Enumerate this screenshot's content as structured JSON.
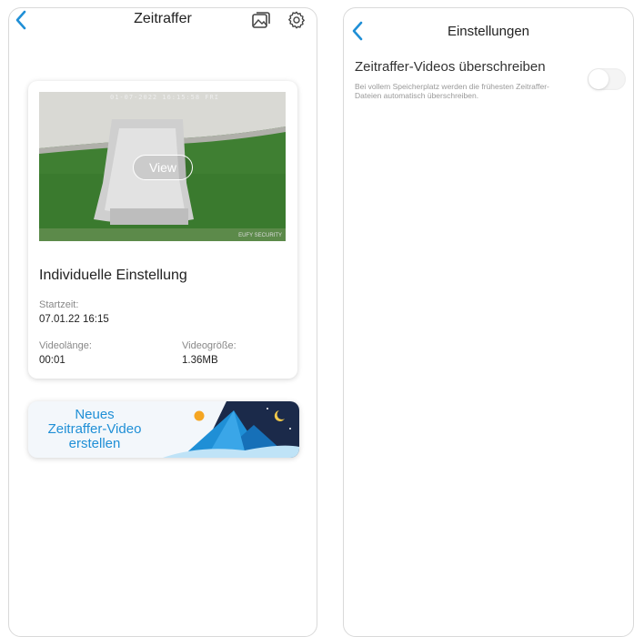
{
  "left": {
    "header": {
      "title": "Zeitraffer",
      "back_icon": "chevron-left-icon",
      "gallery_icon": "gallery-icon",
      "settings_icon": "gear-icon"
    },
    "card": {
      "thumbnail_timestamp": "01-07-2022 16:15:58 FRI",
      "thumbnail_watermark": "EUFY SECURITY",
      "view_label": "View",
      "title": "Individuelle Einstellung",
      "start_label": "Startzeit:",
      "start_value": "07.01.22 16:15",
      "length_label": "Videolänge:",
      "length_value": "00:01",
      "size_label": "Videogröße:",
      "size_value": "1.36MB"
    },
    "banner": {
      "line1": "Neues",
      "line2": "Zeitraffer-Video",
      "line3": "erstellen"
    }
  },
  "right": {
    "header": {
      "title": "Einstellungen",
      "back_icon": "chevron-left-icon"
    },
    "setting": {
      "title": "Zeitraffer-Videos überschreiben",
      "description": "Bei vollem Speicherplatz werden die frühesten Zeitraffer-Dateien automatisch überschreiben.",
      "toggle_on": false
    }
  },
  "colors": {
    "accent": "#1f8fd6",
    "text": "#222222",
    "muted": "#888888"
  }
}
